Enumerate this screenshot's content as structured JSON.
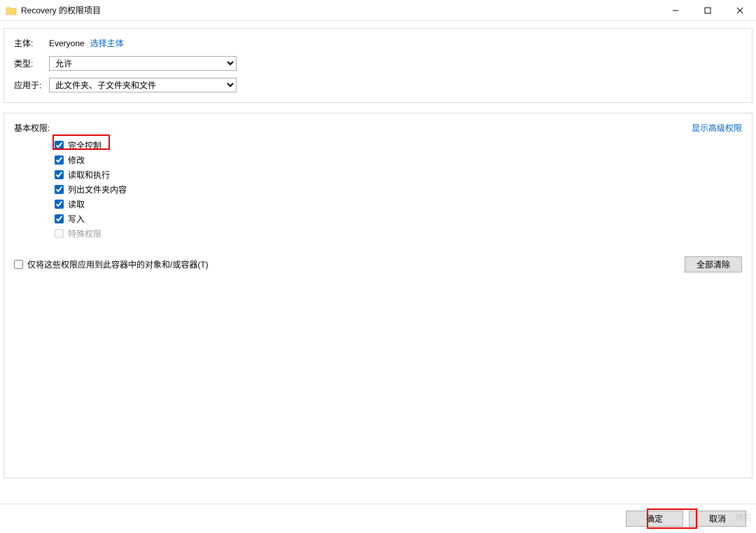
{
  "window": {
    "title": "Recovery 的权限项目"
  },
  "principal": {
    "label": "主体:",
    "name": "Everyone",
    "select_link": "选择主体"
  },
  "type": {
    "label": "类型:",
    "selected": "允许"
  },
  "applies_to": {
    "label": "应用于:",
    "selected": "此文件夹、子文件夹和文件"
  },
  "permissions": {
    "title": "基本权限:",
    "show_advanced": "显示高级权限",
    "items": [
      {
        "label": "完全控制",
        "checked": true,
        "enabled": true
      },
      {
        "label": "修改",
        "checked": true,
        "enabled": true
      },
      {
        "label": "读取和执行",
        "checked": true,
        "enabled": true
      },
      {
        "label": "列出文件夹内容",
        "checked": true,
        "enabled": true
      },
      {
        "label": "读取",
        "checked": true,
        "enabled": true
      },
      {
        "label": "写入",
        "checked": true,
        "enabled": true
      },
      {
        "label": "特殊权限",
        "checked": false,
        "enabled": false
      }
    ]
  },
  "only_apply": {
    "label": "仅将这些权限应用到此容器中的对象和/或容器(T)",
    "checked": false
  },
  "buttons": {
    "clear_all": "全部清除",
    "ok": "确定",
    "cancel": "取消"
  },
  "watermark": "博客"
}
